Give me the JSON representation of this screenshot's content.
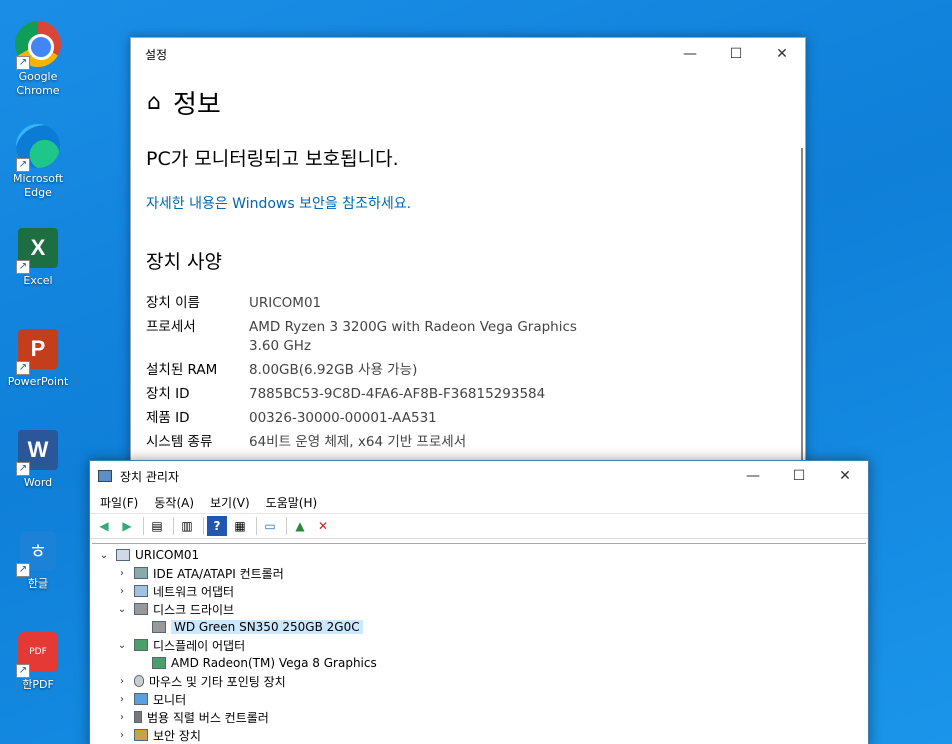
{
  "desktop": {
    "icons": [
      {
        "label_line1": "Google",
        "label_line2": "Chrome"
      },
      {
        "label_line1": "Microsoft",
        "label_line2": "Edge"
      },
      {
        "label_line1": "Excel",
        "label_line2": ""
      },
      {
        "label_line1": "PowerPoint",
        "label_line2": ""
      },
      {
        "label_line1": "Word",
        "label_line2": ""
      },
      {
        "label_line1": "한글",
        "label_line2": ""
      },
      {
        "label_line1": "한PDF",
        "label_line2": ""
      }
    ]
  },
  "settings": {
    "window_title": "설정",
    "page_title": "정보",
    "status": "PC가 모니터링되고 보호됩니다.",
    "security_link": "자세한 내용은 Windows 보안을 참조하세요.",
    "section_title": "장치 사양",
    "specs": [
      {
        "key": "장치 이름",
        "value": "URICOM01"
      },
      {
        "key": "프로세서",
        "value": "AMD Ryzen 3 3200G with Radeon Vega Graphics",
        "value2": "3.60 GHz"
      },
      {
        "key": "설치된 RAM",
        "value": "8.00GB(6.92GB 사용 가능)"
      },
      {
        "key": "장치 ID",
        "value": "7885BC53-9C8D-4FA6-AF8B-F36815293584"
      },
      {
        "key": "제품 ID",
        "value": "00326-30000-00001-AA531"
      },
      {
        "key": "시스템 종류",
        "value": "64비트 운영 체제, x64 기반 프로세서"
      }
    ]
  },
  "devmgr": {
    "window_title": "장치 관리자",
    "menus": [
      "파일(F)",
      "동작(A)",
      "보기(V)",
      "도움말(H)"
    ],
    "tree": {
      "root": "URICOM01",
      "items": [
        {
          "label": "IDE ATA/ATAPI 컨트롤러",
          "expander": "›"
        },
        {
          "label": "네트워크 어댑터",
          "expander": "›"
        },
        {
          "label": "디스크 드라이브",
          "expander": "⌄"
        },
        {
          "label": "WD Green SN350 250GB 2G0C",
          "expander": ""
        },
        {
          "label": "디스플레이 어댑터",
          "expander": "⌄"
        },
        {
          "label": "AMD Radeon(TM) Vega 8 Graphics",
          "expander": ""
        },
        {
          "label": "마우스 및 기타 포인팅 장치",
          "expander": "›"
        },
        {
          "label": "모니터",
          "expander": "›"
        },
        {
          "label": "범용 직렬 버스 컨트롤러",
          "expander": "›"
        },
        {
          "label": "보안 장치",
          "expander": "›"
        }
      ]
    }
  }
}
